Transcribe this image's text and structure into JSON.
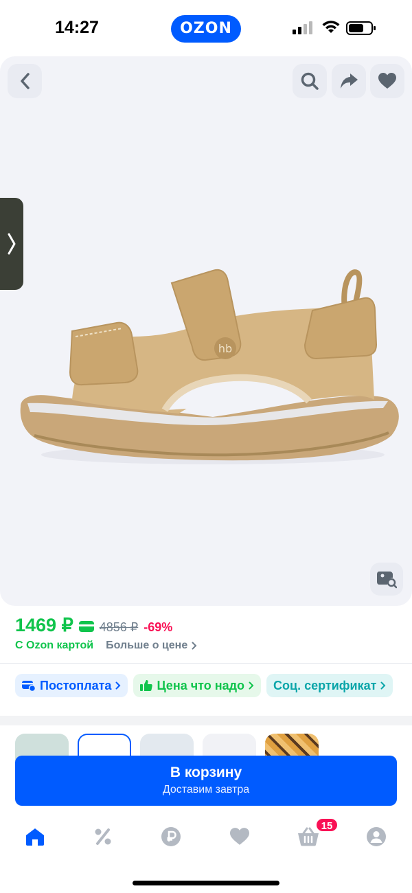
{
  "status_bar": {
    "time": "14:27",
    "brand": "OZON"
  },
  "icons": {
    "back": "chevron-left-icon",
    "search": "search-icon",
    "share": "share-icon",
    "favorite": "heart-icon",
    "gallery": "chevron-right-icon",
    "visual_search": "image-search-icon"
  },
  "product": {
    "price_current": "1469 ₽",
    "price_old": "4856 ₽",
    "discount": "-69%",
    "with_card": "С Ozon картой",
    "more_price": "Больше о цене"
  },
  "chips": [
    {
      "label": "Постоплата"
    },
    {
      "label": "Цена что надо"
    },
    {
      "label": "Соц. сертификат"
    }
  ],
  "cart_button": {
    "label": "В корзину",
    "sub": "Доставим завтра"
  },
  "nav": {
    "cart_badge": "15",
    "items": [
      "home-icon",
      "discount-icon",
      "ozon-bank-icon",
      "favorites-icon",
      "cart-icon",
      "profile-icon"
    ]
  },
  "colors": {
    "brand": "#005bff",
    "price": "#10c44c",
    "discount": "#f91155"
  }
}
